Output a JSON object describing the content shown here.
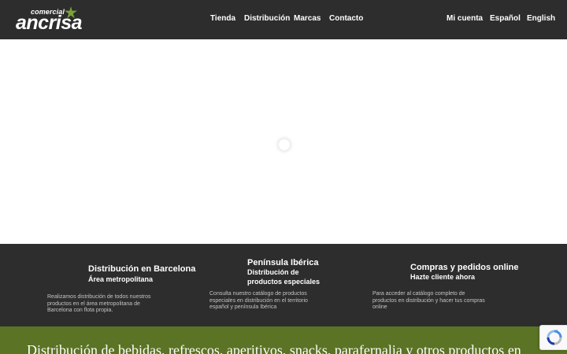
{
  "logo": {
    "top": "comercial",
    "main": "ancrisa"
  },
  "nav": {
    "primary": [
      "Tienda",
      "Distribución",
      "Marcas",
      "Contacto"
    ],
    "secondary": [
      "Mi cuenta",
      "Español",
      "English"
    ]
  },
  "features": [
    {
      "title": "Distribución en Barcelona",
      "subtitle": "Área metropolitana",
      "description": "Realizamos distribución de todos nuestros productos en el área metropolitana de Barcelona con flota propia."
    },
    {
      "title": "Península Ibérica",
      "subtitle": "Distribución de productos especiales",
      "description": "Consulta nuestro catálogo de productos especiales en distribución en el territorio español y península Ibérica"
    },
    {
      "title": "Compras y pedidos online",
      "subtitle": "Hazte cliente ahora",
      "description": "Para acceder al catálogo completo de productos en distribución y hacer tus compras online"
    }
  ],
  "banner": {
    "text": "Distribución de bebidas, refrescos, aperitivos, snacks, parafernalia y otros productos en"
  },
  "colors": {
    "header_bg": "#2d2d2d",
    "banner_green": "#5b7324",
    "logo_star": "#7aa33a"
  },
  "icons": {
    "logo_star": "star-icon",
    "recaptcha": "recaptcha-icon",
    "loading": "loading-spinner"
  }
}
